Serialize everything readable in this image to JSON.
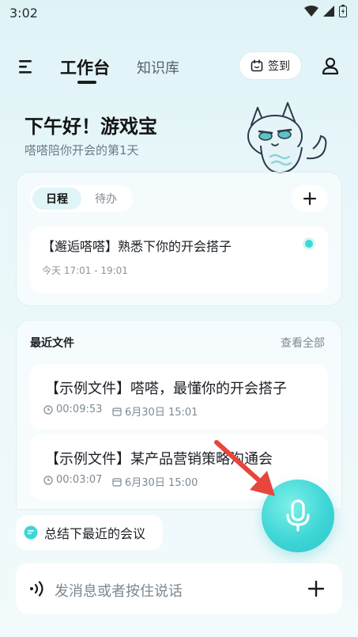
{
  "status_bar": {
    "time": "3:02"
  },
  "header": {
    "tab_active": "工作台",
    "tab_inactive": "知识库",
    "checkin_label": "签到"
  },
  "greeting": {
    "title": "下午好！游戏宝",
    "subtitle": "嗒嗒陪你开会的第1天"
  },
  "schedule": {
    "segments": [
      "日程",
      "待办"
    ],
    "event": {
      "title": "【邂逅嗒嗒】熟悉下你的开会搭子",
      "time": "今天 17:01 - 19:01"
    }
  },
  "files": {
    "title": "最近文件",
    "view_all": "查看全部",
    "items": [
      {
        "title": "【示例文件】嗒嗒，最懂你的开会搭子",
        "duration": "00:09:53",
        "date": "6月30日 15:01"
      },
      {
        "title": "【示例文件】某产品营销策略沟通会",
        "duration": "00:03:07",
        "date": "6月30日 15:00"
      }
    ]
  },
  "suggestion": {
    "label": "总结下最近的会议"
  },
  "composer": {
    "placeholder": "发消息或者按住说话"
  },
  "colors": {
    "accent": "#3fd6d6",
    "annotation_arrow": "#e8453c"
  }
}
